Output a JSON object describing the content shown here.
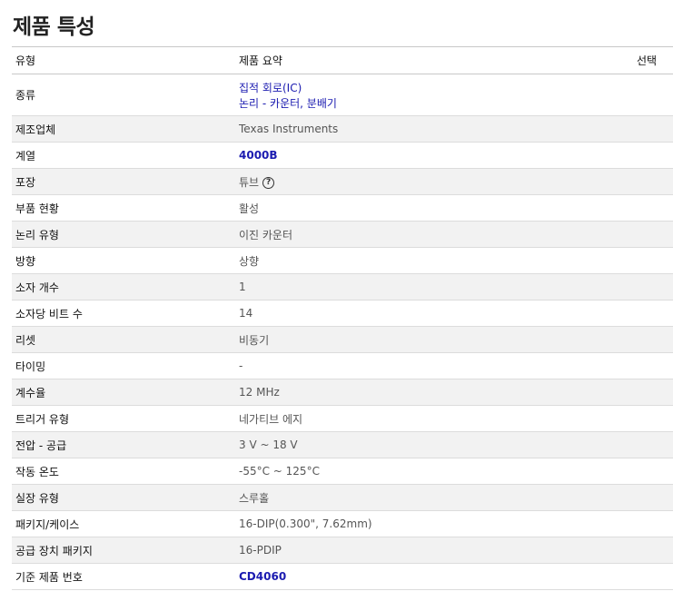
{
  "page_title": "제품 특성",
  "headers": {
    "type": "유형",
    "summary": "제품 요약",
    "select": "선택"
  },
  "rows": [
    {
      "attr": "종류",
      "value_line1": "집적 회로(IC)",
      "value_line2": "논리 - 카운터, 분배기"
    },
    {
      "attr": "제조업체",
      "value": "Texas Instruments"
    },
    {
      "attr": "계열",
      "value": "4000B"
    },
    {
      "attr": "포장",
      "value": "튜브",
      "icon": "help-icon"
    },
    {
      "attr": "부품 현황",
      "value": "활성"
    },
    {
      "attr": "논리 유형",
      "value": "이진 카운터"
    },
    {
      "attr": "방향",
      "value": "상향"
    },
    {
      "attr": "소자 개수",
      "value": "1"
    },
    {
      "attr": "소자당 비트 수",
      "value": "14"
    },
    {
      "attr": "리셋",
      "value": "비동기"
    },
    {
      "attr": "타이밍",
      "value": "-"
    },
    {
      "attr": "계수율",
      "value": "12 MHz"
    },
    {
      "attr": "트리거 유형",
      "value": "네가티브 에지"
    },
    {
      "attr": "전압 - 공급",
      "value": "3 V ~ 18 V"
    },
    {
      "attr": "작동 온도",
      "value": "-55°C ~ 125°C"
    },
    {
      "attr": "실장 유형",
      "value": "스루홀"
    },
    {
      "attr": "패키지/케이스",
      "value": "16-DIP(0.300\", 7.62mm)"
    },
    {
      "attr": "공급 장치 패키지",
      "value": "16-PDIP"
    },
    {
      "attr": "기준 제품 번호",
      "value": "CD4060"
    }
  ]
}
